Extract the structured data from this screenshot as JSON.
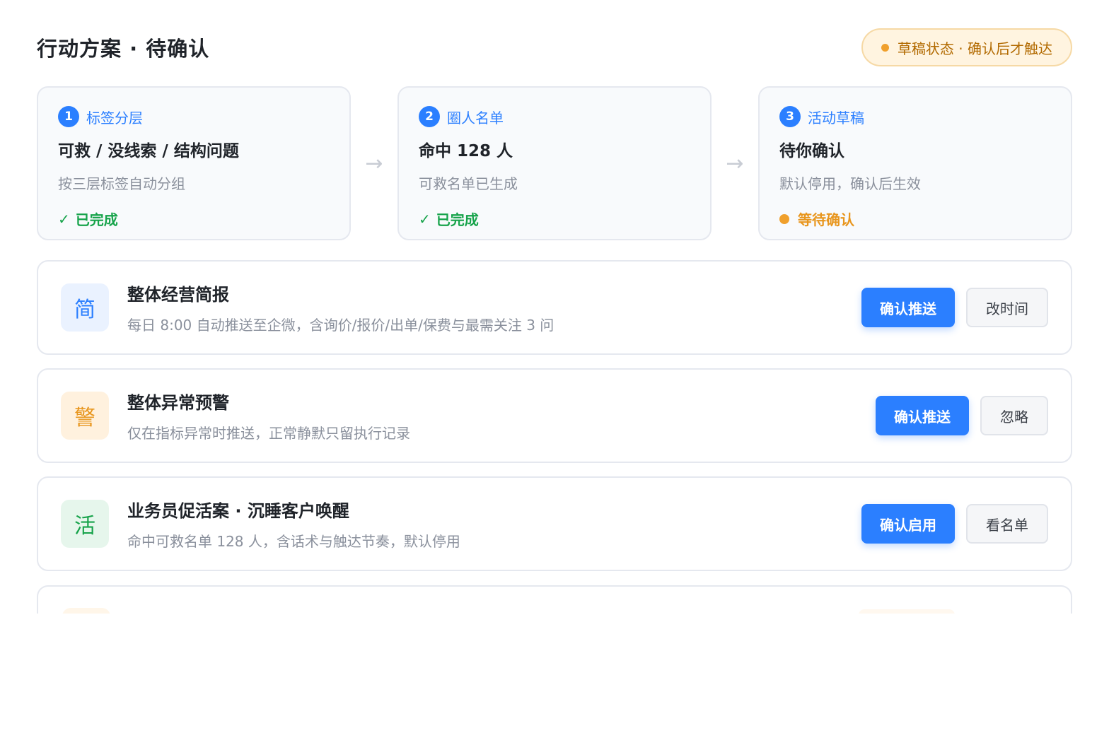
{
  "header": {
    "title": "行动方案 · 待确认",
    "badge": "草稿状态 · 确认后才触达"
  },
  "steps": [
    {
      "num": "1",
      "label": "标签分层",
      "title": "可救 / 没线索 / 结构问题",
      "desc": "按三层标签自动分组",
      "status": "已完成",
      "status_type": "done"
    },
    {
      "num": "2",
      "label": "圈人名单",
      "title": "命中 128 人",
      "desc": "可救名单已生成",
      "status": "已完成",
      "status_type": "done"
    },
    {
      "num": "3",
      "label": "活动草稿",
      "title": "待你确认",
      "desc": "默认停用，确认后生效",
      "status": "等待确认",
      "status_type": "waiting"
    }
  ],
  "step_arrow": "→",
  "check_mark": "✓",
  "actions": [
    {
      "icon_text": "简",
      "icon_color": "#2b7fff",
      "title": "整体经营简报",
      "desc": "每日 8:00 自动推送至企微，含询价/报价/出单/保费与最需关注 3 问",
      "primary": "确认推送",
      "secondary": "改时间"
    },
    {
      "icon_text": "警",
      "icon_color": "#e8961e",
      "title": "整体异常预警",
      "desc": "仅在指标异常时推送，正常静默只留执行记录",
      "primary": "确认推送",
      "secondary": "忽略"
    },
    {
      "icon_text": "活",
      "icon_color": "#16a34a",
      "title": "业务员促活案 · 沉睡客户唤醒",
      "desc": "命中可救名单 128 人，含话术与触达节奏，默认停用",
      "primary": "确认启用",
      "secondary": "看名单"
    }
  ],
  "colors": {
    "accent": "#2b7fff",
    "done": "#16a34a",
    "waiting": "#e8961e"
  }
}
